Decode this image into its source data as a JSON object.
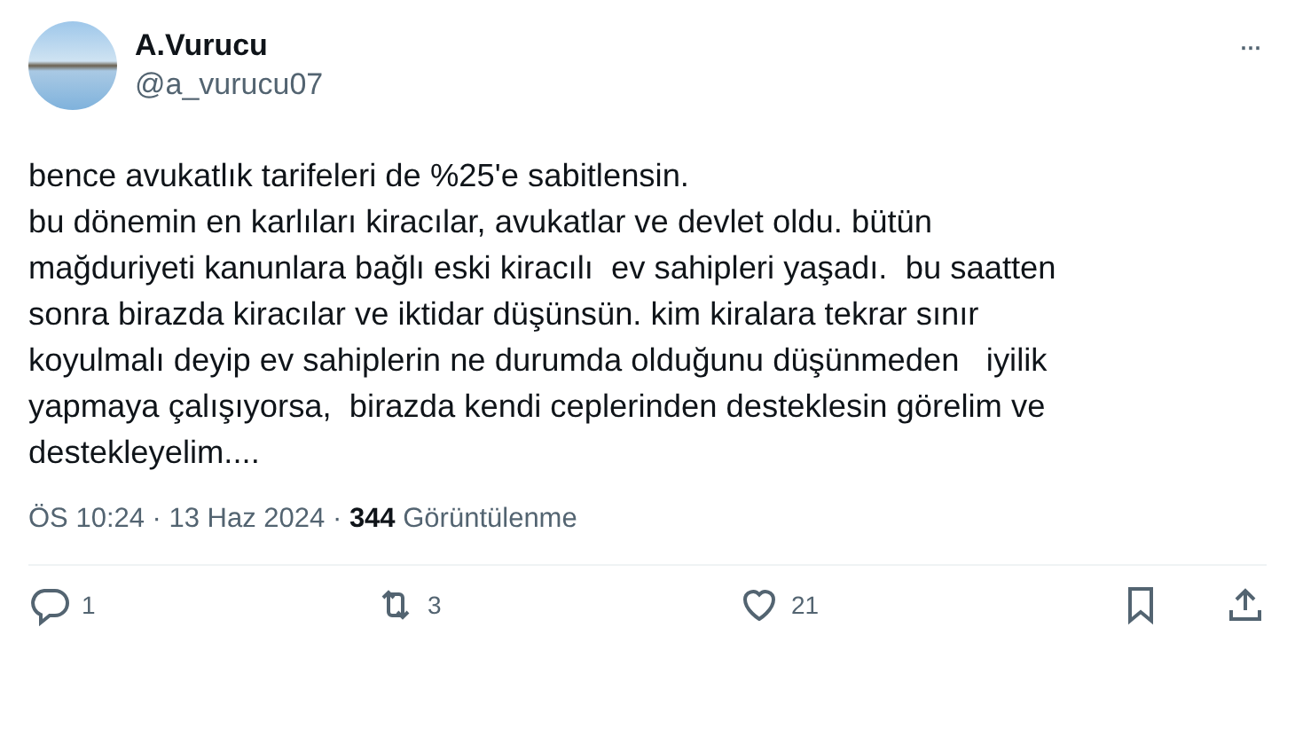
{
  "author": {
    "name": "A.Vurucu",
    "handle": "@a_vurucu07"
  },
  "more_menu": "···",
  "body_lines": [
    "bence avukatlık tarifeleri de %25'e sabitlensin.",
    "bu dönemin en karlıları kiracılar, avukatlar ve devlet oldu. bütün",
    "mağduriyeti kanunlara bağlı eski kiracılı  ev sahipleri yaşadı.  bu saatten",
    "sonra birazda kiracılar ve iktidar düşünsün. kim kiralara tekrar sınır",
    "koyulmalı deyip ev sahiplerin ne durumda olduğunu düşünmeden   iyilik",
    "yapmaya çalışıyorsa,  birazda kendi ceplerinden desteklesin görelim ve",
    "destekleyelim...."
  ],
  "meta": "ÖS 10:24 · 13 Haz 2024 · **344** Görüntülenme",
  "actions": [
    {
      "kind": "reply",
      "count": "1"
    },
    {
      "kind": "repost",
      "count": "3"
    },
    {
      "kind": "like",
      "count": "21"
    },
    {
      "kind": "bookmark"
    },
    {
      "kind": "share"
    }
  ]
}
